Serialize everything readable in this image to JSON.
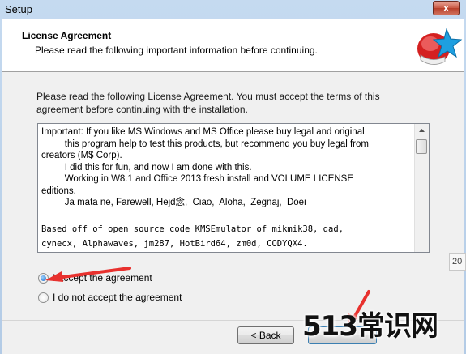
{
  "window": {
    "title": "Setup",
    "close_symbol": "x"
  },
  "header": {
    "title": "License Agreement",
    "subtitle": "Please read the following important information before continuing."
  },
  "intro": "Please read the following License Agreement. You must accept the terms of this agreement before continuing with the installation.",
  "license_lines": [
    "Important: If you like MS Windows and MS Office please buy legal and original",
    "         this program help to test this products, but recommend you buy legal from",
    "creators (M$ Corp).",
    "         I did this for fun, and now I am done with this.",
    "         Working in W8.1 and Office 2013 fresh install and VOLUME LICENSE",
    "editions.",
    "         Ja mata ne, Farewell, Hejd念,  Ciao,  Aloha,  Zegnaj,  Doei"
  ],
  "license_lines_mono": [
    "Based off of open source code KMSEmulator of mikmik38, qad,",
    "cynecx, Alphawaves, jm287, HotBird64, zm0d, CODYQX4."
  ],
  "radios": [
    {
      "label": "I accept the agreement",
      "checked": true
    },
    {
      "label": "I do not accept the agreement",
      "checked": false
    }
  ],
  "buttons": {
    "back": "< Back"
  },
  "side_tab": "20",
  "watermark": "513常识网",
  "colors": {
    "accent": "#3c7fb1",
    "arrow": "#e8312e",
    "close": "#c95a45"
  }
}
